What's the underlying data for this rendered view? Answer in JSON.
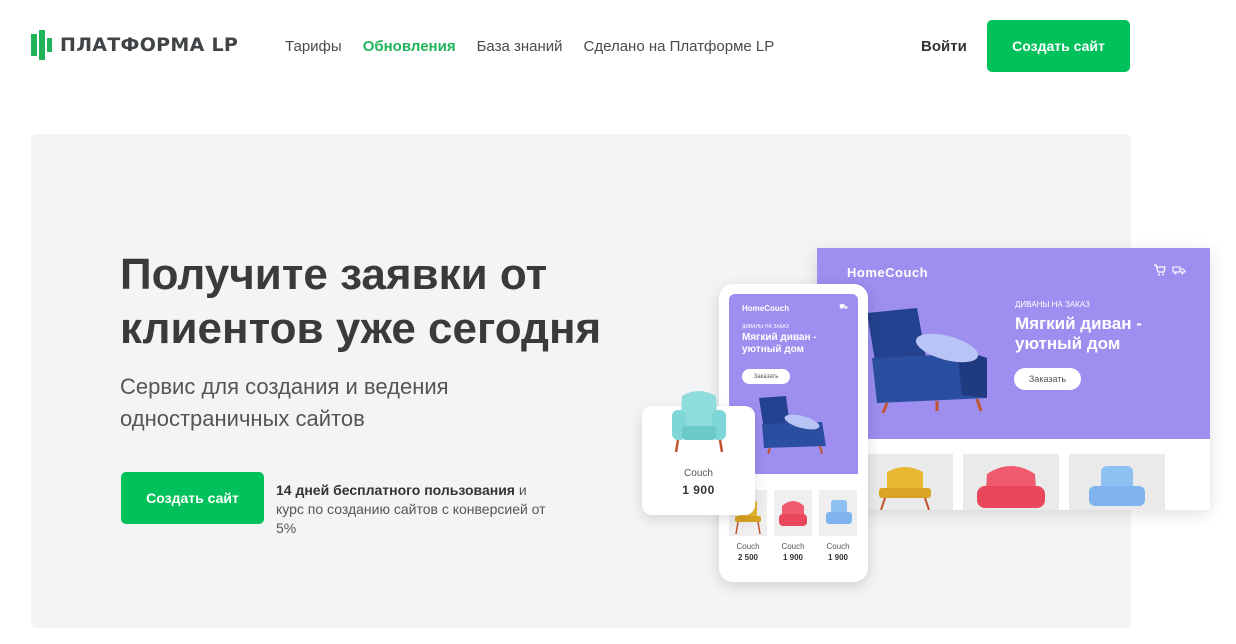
{
  "header": {
    "logo_text": "ПЛАТФОРМА LP",
    "nav": [
      {
        "label": "Тарифы",
        "active": false
      },
      {
        "label": "Обновления",
        "active": true
      },
      {
        "label": "База знаний",
        "active": false
      },
      {
        "label": "Сделано на Платформе LP",
        "active": false
      }
    ],
    "login_label": "Войти",
    "cta_label": "Создать сайт"
  },
  "hero": {
    "title": "Получите заявки от клиентов уже сегодня",
    "subtitle": "Сервис для создания и ведения одностраничных сайтов",
    "cta_label": "Создать сайт",
    "note_bold": "14 дней бесплатного пользования",
    "note_rest": " и курс по созданию сайтов с конверсией от 5%"
  },
  "desktop_mockup": {
    "brand": "HomeCouch",
    "icons": [
      "cart-icon",
      "truck-icon"
    ],
    "kicker": "ДИВАНЫ НА ЗАКАЗ",
    "title": "Мягкий диван - уютный дом",
    "button": "Заказать"
  },
  "phone_mockup": {
    "brand": "HomeCouch",
    "kicker": "ДИВАНЫ НА ЗАКАЗ",
    "title": "Мягкий диван - уютный дом",
    "button": "Заказать",
    "products": [
      {
        "name": "Couch",
        "price": "2 500",
        "color": "#e8b830"
      },
      {
        "name": "Couch",
        "price": "1 900",
        "color": "#f05a6e"
      },
      {
        "name": "Couch",
        "price": "1 900",
        "color": "#7fb4ee"
      }
    ]
  },
  "floating_card": {
    "name": "Couch",
    "price": "1 900",
    "color": "#7fd6d6"
  },
  "colors": {
    "accent": "#00c15a",
    "mockup_purple": "#9d8ef0",
    "sofa_blue": "#2b4fa0"
  }
}
